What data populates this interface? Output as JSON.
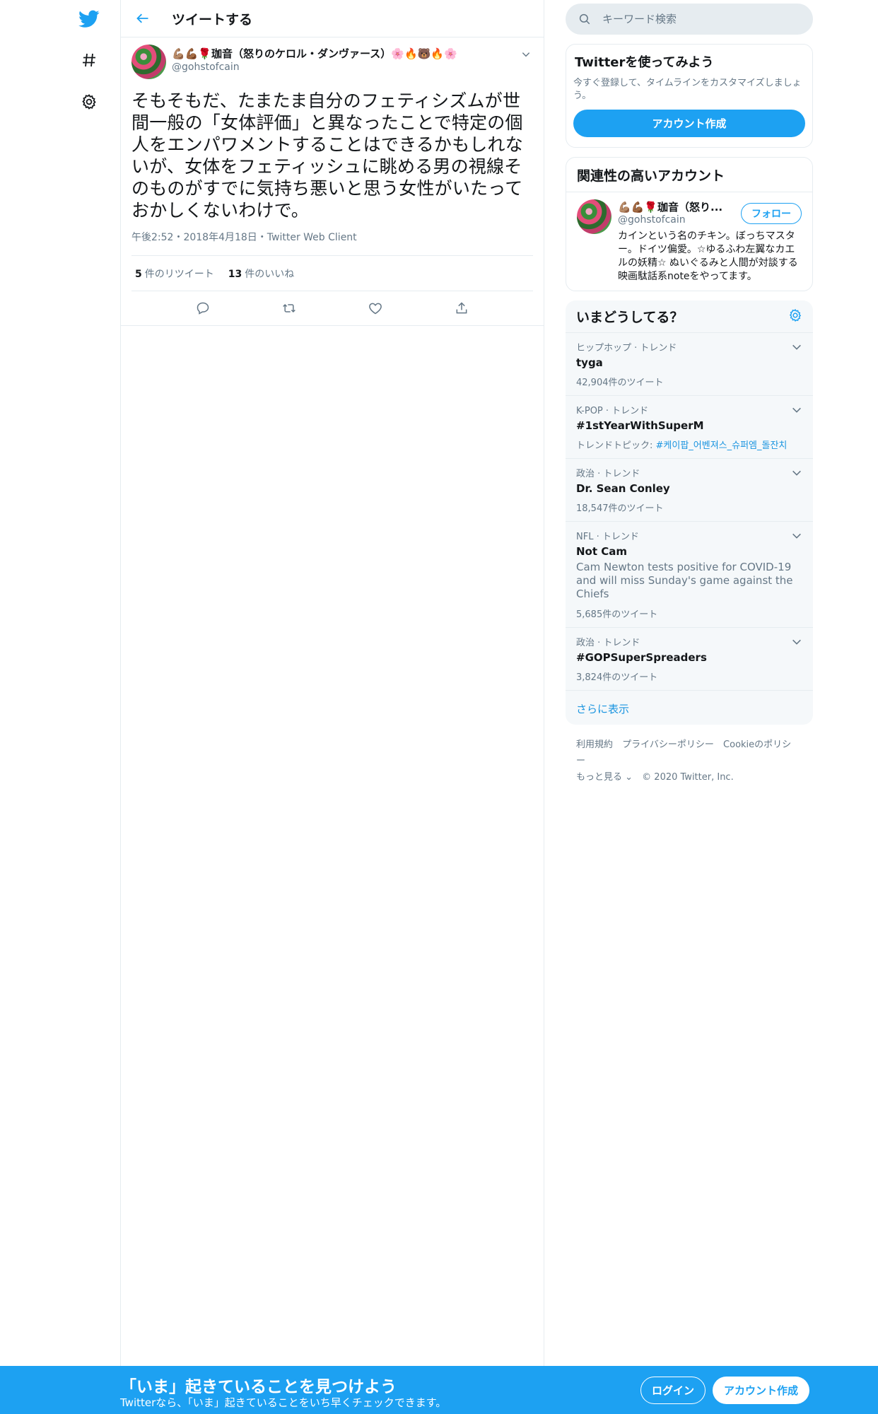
{
  "topbar": {
    "title": "ツイートする"
  },
  "tweet": {
    "author_name": "💪🏽💪🏾🌹珈音（怒りのケロル・ダンヴァース）🌸🔥🐻🔥🌸",
    "author_handle": "@gohstofcain",
    "text": "そもそもだ、たまたま自分のフェティシズムが世間一般の「女体評価」と異なったことで特定の個人をエンパワメントすることはできるかもしれないが、女体をフェティッシュに眺める男の視線そのものがすでに気持ち悪いと思う女性がいたっておかしくないわけで。",
    "meta": "午後2:52・2018年4月18日・Twitter Web Client",
    "retweet_count": "5",
    "retweet_label": "件のリツイート",
    "like_count": "13",
    "like_label": "件のいいね"
  },
  "search": {
    "placeholder": "キーワード検索"
  },
  "signup_card": {
    "title": "Twitterを使ってみよう",
    "desc": "今すぐ登録して、タイムラインをカスタマイズしましょう。",
    "button": "アカウント作成"
  },
  "related": {
    "title": "関連性の高いアカウント",
    "name": "💪🏽💪🏾🌹珈音（怒り...",
    "handle": "@gohstofcain",
    "bio": "カインという名のチキン。ぼっちマスター。ドイツ偏愛。☆ゆるふわ左翼なカエルの妖精☆ ぬいぐるみと人間が対談する映画駄話系noteをやってます。",
    "follow": "フォロー"
  },
  "trends": {
    "title": "いまどうしてる？",
    "items": [
      {
        "category": "ヒップホップ · トレンド",
        "name": "tyga",
        "count": "42,904件のツイート"
      },
      {
        "category": "K-POP · トレンド",
        "name": "#1stYearWithSuperM",
        "topic_label": "トレンドトピック: ",
        "topic_link": "#케이팝_어벤져스_슈퍼엠_돌잔치"
      },
      {
        "category": "政治 · トレンド",
        "name": "Dr. Sean Conley",
        "count": "18,547件のツイート"
      },
      {
        "category": "NFL · トレンド",
        "name": "Not Cam",
        "desc": "Cam Newton tests positive for COVID-19 and will miss Sunday's game against the Chiefs",
        "count": "5,685件のツイート"
      },
      {
        "category": "政治 · トレンド",
        "name": "#GOPSuperSpreaders",
        "count": "3,824件のツイート"
      }
    ],
    "more": "さらに表示"
  },
  "footer": {
    "terms": "利用規約",
    "privacy": "プライバシーポリシー",
    "cookie": "Cookieのポリシー",
    "more": "もっと見る ⌄",
    "copyright": "© 2020 Twitter, Inc."
  },
  "banner": {
    "title": "「いま」起きていることを見つけよう",
    "subtitle": "Twitterなら、「いま」起きていることをいち早くチェックできます。",
    "login": "ログイン",
    "signup": "アカウント作成"
  },
  "colors": {
    "brand": "#1da1f2",
    "link": "#1b95e0",
    "muted": "#657786"
  }
}
